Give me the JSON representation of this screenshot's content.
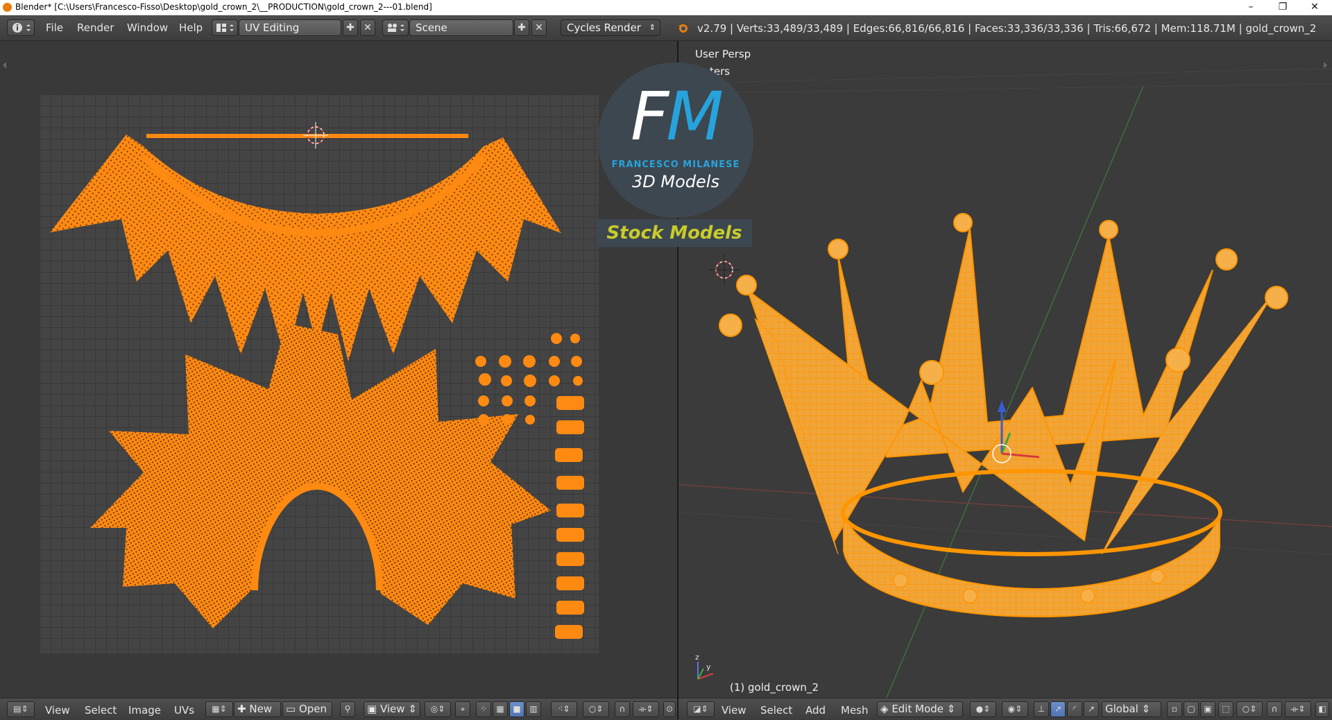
{
  "window": {
    "title": "Blender* [C:\\Users\\Francesco-Fisso\\Desktop\\gold_crown_2\\__PRODUCTION\\gold_crown_2---01.blend]",
    "minimize_glyph": "–",
    "restore_glyph": "❐",
    "close_glyph": "✕"
  },
  "header": {
    "menus": [
      "File",
      "Render",
      "Window",
      "Help"
    ],
    "layout": "UV Editing",
    "scene": "Scene",
    "engine": "Cycles Render",
    "status": "v2.79 | Verts:33,489/33,489 | Edges:66,816/66,816 | Faces:33,336/33,336 | Tris:66,672 | Mem:118.71M | gold_crown_2"
  },
  "viewport": {
    "view_name": "User Persp",
    "partial_label": "ters",
    "object_label": "(1) gold_crown_2"
  },
  "logo": {
    "f": "F",
    "m": "M",
    "name": "FRANCESCO MILANESE",
    "sub": "3D Models",
    "banner": "Stock Models"
  },
  "uv_footer": {
    "menus": [
      "View",
      "Select",
      "Image",
      "UVs"
    ],
    "new_label": "New",
    "open_label": "Open",
    "view_label": "View"
  },
  "vp_footer": {
    "menus": [
      "View",
      "Select",
      "Add",
      "Mesh"
    ],
    "mode": "Edit Mode",
    "orientation": "Global"
  },
  "colors": {
    "uv_island": "#ff8a12",
    "crown_fill": "#f0a53a",
    "crown_wire": "#ff9500",
    "logo_blue": "#27a3dc",
    "banner_yellow": "#c8cc2a"
  }
}
